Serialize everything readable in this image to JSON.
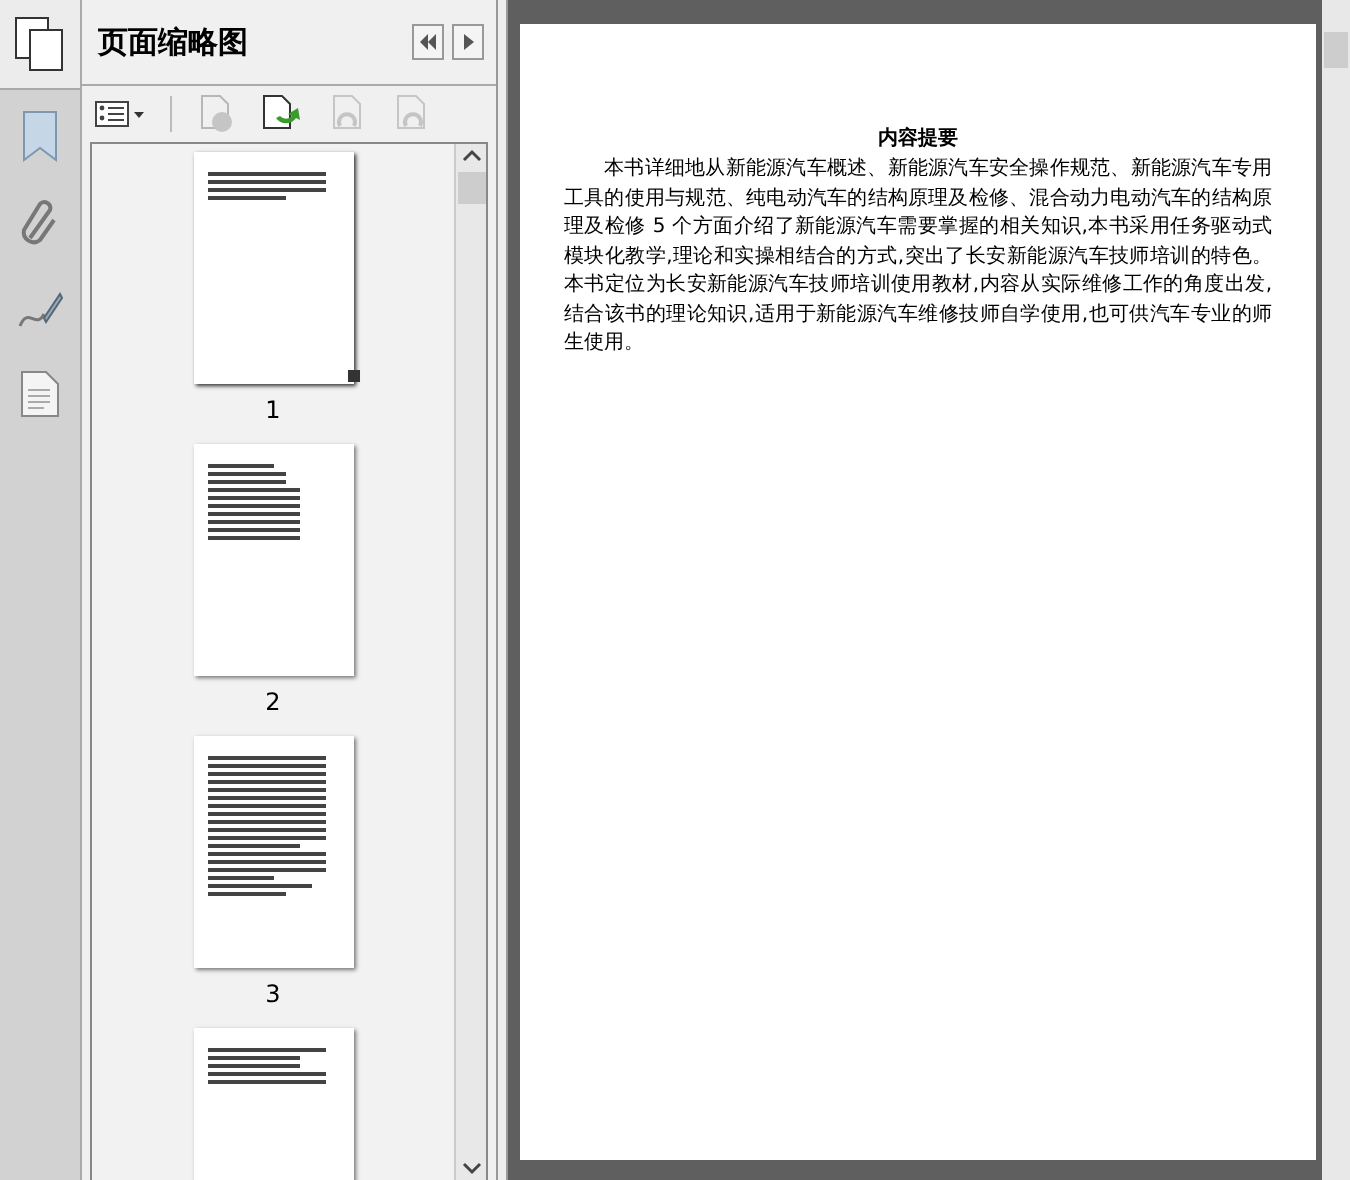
{
  "panel": {
    "title": "页面缩略图"
  },
  "thumbnails": [
    {
      "label": "1",
      "selected": true,
      "kind": "summary"
    },
    {
      "label": "2",
      "selected": false,
      "kind": "table"
    },
    {
      "label": "3",
      "selected": false,
      "kind": "text"
    },
    {
      "selected": false,
      "kind": "contents"
    }
  ],
  "document": {
    "heading": "内容提要",
    "paragraph": "本书详细地从新能源汽车概述、新能源汽车安全操作规范、新能源汽车专用工具的使用与规范、纯电动汽车的结构原理及检修、混合动力电动汽车的结构原理及检修 5 个方面介绍了新能源汽车需要掌握的相关知识,本书采用任务驱动式模块化教学,理论和实操相结合的方式,突出了长安新能源汽车技师培训的特色。本书定位为长安新能源汽车技师培训使用教材,内容从实际维修工作的角度出发,结合该书的理论知识,适用于新能源汽车维修技师自学使用,也可供汽车专业的师生使用。"
  }
}
